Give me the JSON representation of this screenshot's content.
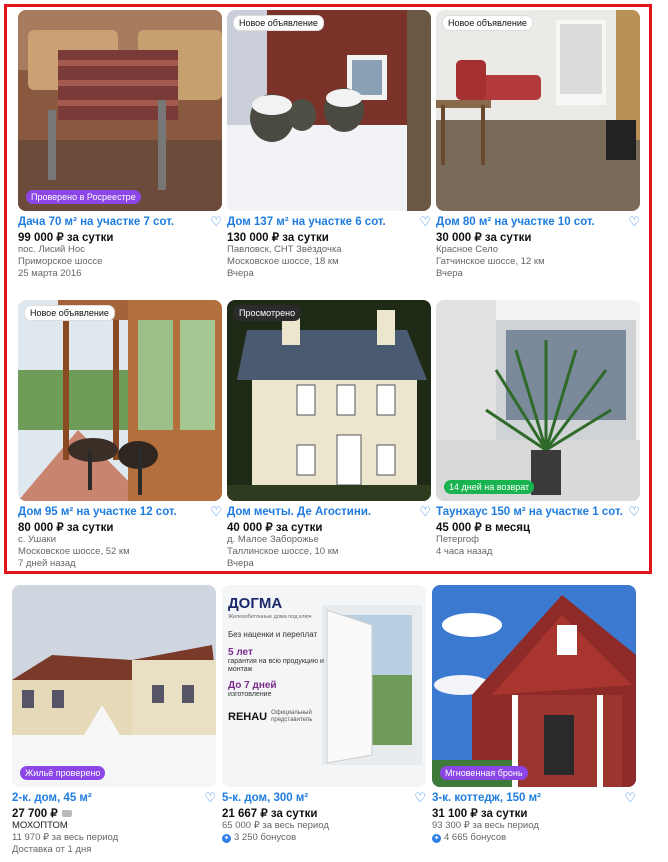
{
  "colors": {
    "accent": "#1f7de0",
    "highlight": "#e3141b",
    "verified": "#8c46e8",
    "return": "#19b34f"
  },
  "cards": [
    {
      "title": "Дача 70 м² на участке 7 сот.",
      "price": "99 000 ₽ за сутки",
      "l1": "пос. Лисий Нос",
      "l2": "Приморское шоссе",
      "l3": "25 марта 2016",
      "badge_bottom": "Проверено в Росреестре"
    },
    {
      "title": "Дом 137 м² на участке 6 сот.",
      "price": "130 000 ₽ за сутки",
      "l1": "Павловск, СНТ Звёздочка",
      "l2": "Московское шоссе, 18 км",
      "l3": "Вчера",
      "badge_top": "Новое объявление"
    },
    {
      "title": "Дом 80 м² на участке 10 сот.",
      "price": "30 000 ₽ за сутки",
      "l1": "Красное Село",
      "l2": "Гатчинское шоссе, 12 км",
      "l3": "Вчера",
      "badge_top": "Новое объявление"
    },
    {
      "title": "Дом 95 м² на участке 12 сот.",
      "price": "80 000 ₽ за сутки",
      "l1": "с. Ушаки",
      "l2": "Московское шоссе, 52 км",
      "l3": "7 дней назад",
      "badge_top": "Новое объявление"
    },
    {
      "title": "Дом мечты. Де Агостини.",
      "price": "40 000 ₽ за сутки",
      "l1": "д. Малое Заборожье",
      "l2": "Таллинское шоссе, 10 км",
      "l3": "Вчера",
      "badge_top": "Просмотрено"
    },
    {
      "title": "Таунхаус 150 м² на участке 1 сот.",
      "price": "45 000 ₽ в месяц",
      "l1": "Петергоф",
      "l2": "4 часа назад",
      "badge_bottom": "14 дней на возврат"
    },
    {
      "title": "2-к. дом, 45 м²",
      "price": "27 700 ₽",
      "l1": "МОХОПТОМ",
      "l2": "11 970 ₽ за весь период",
      "l3": "Доставка от 1 дня",
      "badge_bottom": "Жильё проверено"
    },
    {
      "title": "5-к. дом, 300 м²",
      "price": "21 667 ₽ за сутки",
      "l1": "65 000 ₽ за весь период",
      "l2": "3 250 бонусов"
    },
    {
      "title": "3-к. коттедж, 150 м²",
      "price": "31 100 ₽ за сутки",
      "l1": "93 300 ₽ за весь период",
      "l2": "4 665 бонусов",
      "badge_bottom": "Мгновенная бронь"
    }
  ],
  "ad": {
    "brand": "ДОГМА",
    "small": "Железобетонные дома под ключ",
    "f1": "Без наценки и переплат",
    "f2a": "5 лет",
    "f2b": "гарантия на всю продукцию и монтаж",
    "f3a": "До 7 дней",
    "f3b": "изготовление",
    "partner": "REHAU",
    "partner_note": "Официальный представитель"
  }
}
